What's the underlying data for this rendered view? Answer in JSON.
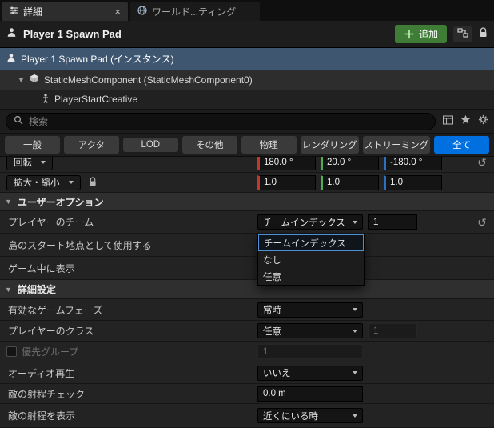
{
  "tabs": {
    "details": "詳細",
    "world_settings": "ワールド...ティング"
  },
  "header": {
    "title": "Player 1 Spawn Pad",
    "add_label": "追加"
  },
  "hierarchy": {
    "items": [
      {
        "label": "Player 1 Spawn Pad (インスタンス)"
      },
      {
        "label": "StaticMeshComponent (StaticMeshComponent0)"
      },
      {
        "label": "PlayerStartCreative"
      }
    ]
  },
  "search": {
    "placeholder": "検索"
  },
  "filters": {
    "items": [
      "一般",
      "アクタ",
      "LOD",
      "その他",
      "物理",
      "レンダリング",
      "ストリーミング",
      "全て"
    ],
    "active": "全て"
  },
  "transform": {
    "rotation": {
      "label": "回転",
      "x": "180.0 °",
      "y": "20.0 °",
      "z": "-180.0 °"
    },
    "scale": {
      "label": "拡大・縮小",
      "x": "1.0",
      "y": "1.0",
      "z": "1.0"
    }
  },
  "user_options": {
    "section": "ユーザーオプション",
    "player_team_label": "プレイヤーのチーム",
    "player_team_value": "チームインデックス",
    "player_team_index": "1",
    "team_options": [
      "チームインデックス",
      "なし",
      "任意"
    ],
    "island_start_label": "島のスタート地点として使用する",
    "show_in_game_label": "ゲーム中に表示"
  },
  "advanced": {
    "section": "詳細設定",
    "game_phase_label": "有効なゲームフェーズ",
    "game_phase_value": "常時",
    "player_class_label": "プレイヤーのクラス",
    "player_class_value": "任意",
    "player_class_index": "1",
    "priority_group_label": "優先グループ",
    "priority_group_value": "1",
    "audio_label": "オーディオ再生",
    "audio_value": "いいえ",
    "enemy_range_check_label": "敵の射程チェック",
    "enemy_range_check_value": "0.0 m",
    "enemy_range_display_label": "敵の射程を表示",
    "enemy_range_display_value": "近くにいる時"
  },
  "colors": {
    "accent": "#0070e0",
    "axis_x": "#c0392b",
    "axis_y": "#4caf50",
    "axis_z": "#2d6fc1"
  }
}
